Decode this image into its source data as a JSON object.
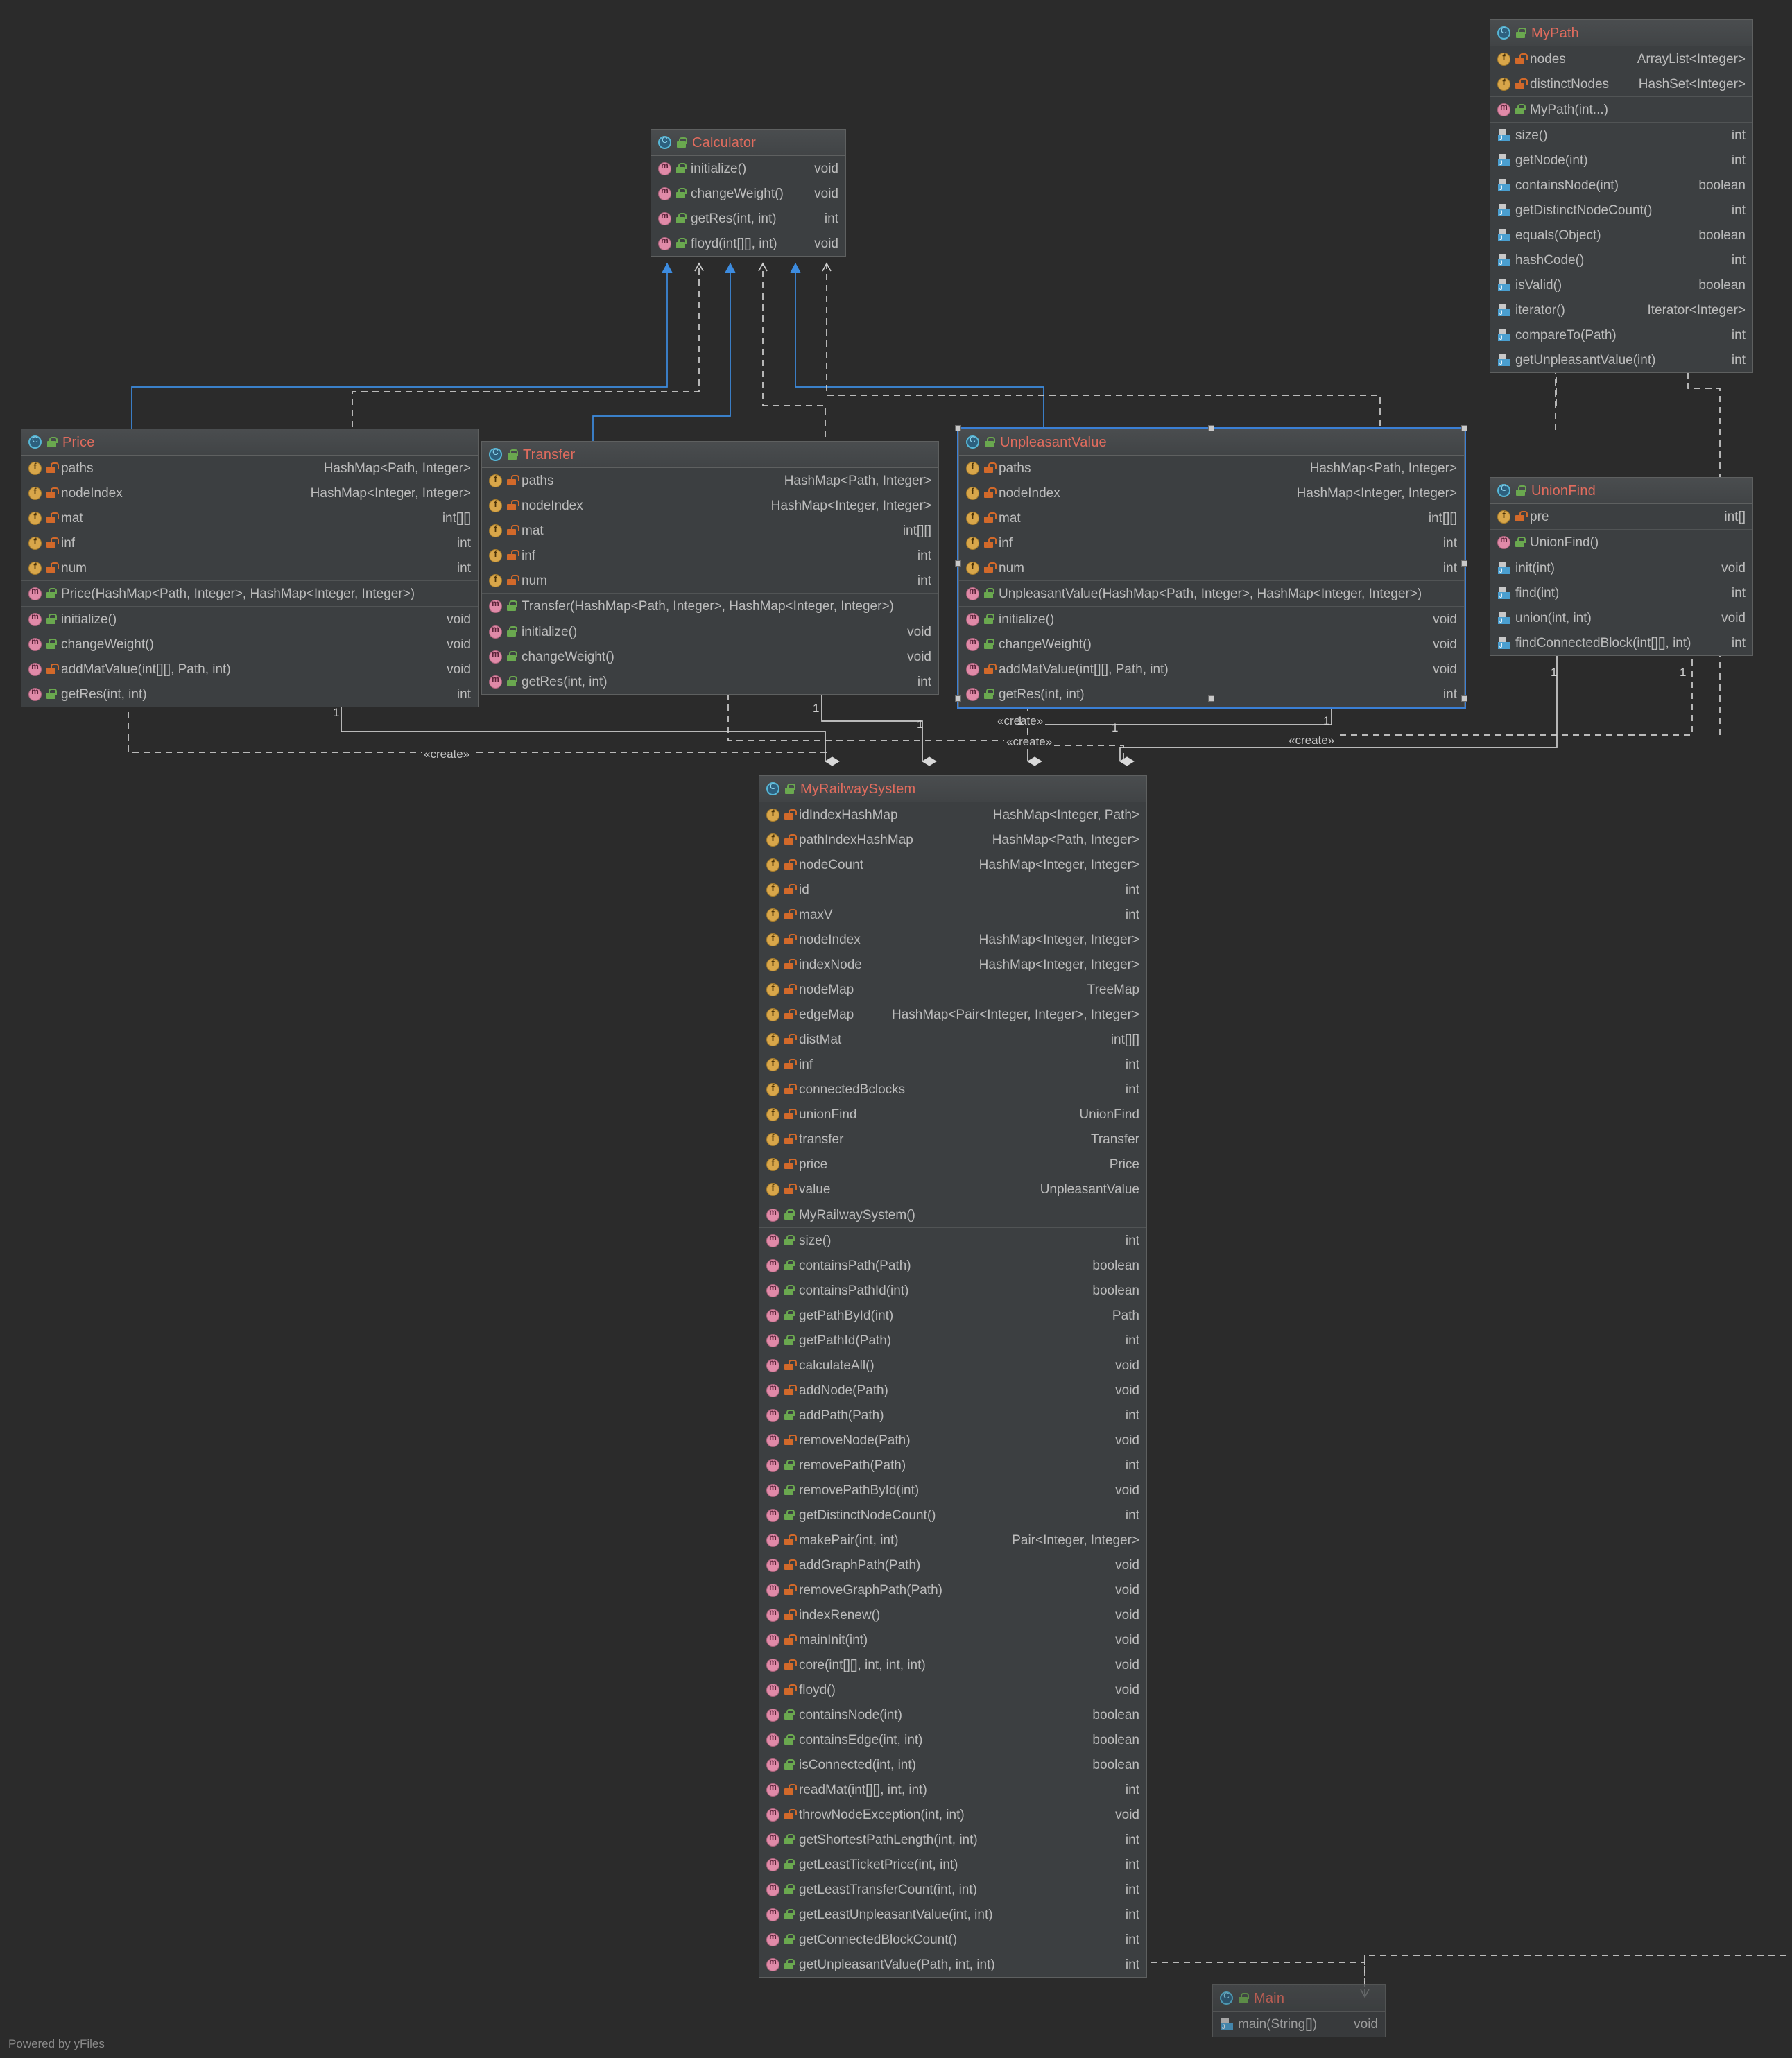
{
  "footer": {
    "text": "Powered by yFiles"
  },
  "edge_labels": [
    "«create»",
    "«create»",
    "«create»",
    "«create»"
  ],
  "multiplicities": [
    "1",
    "1",
    "1",
    "1",
    "1",
    "1",
    "1",
    "1"
  ],
  "classes": {
    "calculator": {
      "name": "Calculator",
      "icon": "class-interface-icon",
      "visibility": "public",
      "sections": [
        {
          "rows": [
            {
              "icon": "method-icon",
              "lock": "public",
              "name": "initialize()",
              "type": "void"
            },
            {
              "icon": "method-icon",
              "lock": "public",
              "name": "changeWeight()",
              "type": "void"
            },
            {
              "icon": "method-icon",
              "lock": "public",
              "name": "getRes(int, int)",
              "type": "int"
            },
            {
              "icon": "method-icon",
              "lock": "public",
              "name": "floyd(int[][], int)",
              "type": "void"
            }
          ]
        }
      ]
    },
    "mypath": {
      "name": "MyPath",
      "icon": "class-icon",
      "visibility": "public",
      "sections": [
        {
          "rows": [
            {
              "icon": "field-icon",
              "lock": "private",
              "name": "nodes",
              "type": "ArrayList<Integer>"
            },
            {
              "icon": "field-icon",
              "lock": "private",
              "name": "distinctNodes",
              "type": "HashSet<Integer>"
            }
          ]
        },
        {
          "rows": [
            {
              "icon": "method-icon",
              "lock": "public",
              "name": "MyPath(int...)",
              "type": ""
            }
          ]
        },
        {
          "rows": [
            {
              "icon": "inherited-icon",
              "lock": "",
              "name": "size()",
              "type": "int"
            },
            {
              "icon": "inherited-icon",
              "lock": "",
              "name": "getNode(int)",
              "type": "int"
            },
            {
              "icon": "inherited-icon",
              "lock": "",
              "name": "containsNode(int)",
              "type": "boolean"
            },
            {
              "icon": "inherited-icon",
              "lock": "",
              "name": "getDistinctNodeCount()",
              "type": "int"
            },
            {
              "icon": "inherited-icon",
              "lock": "",
              "name": "equals(Object)",
              "type": "boolean"
            },
            {
              "icon": "inherited-icon",
              "lock": "",
              "name": "hashCode()",
              "type": "int"
            },
            {
              "icon": "inherited-icon",
              "lock": "",
              "name": "isValid()",
              "type": "boolean"
            },
            {
              "icon": "inherited-icon",
              "lock": "",
              "name": "iterator()",
              "type": "Iterator<Integer>"
            },
            {
              "icon": "inherited-icon",
              "lock": "",
              "name": "compareTo(Path)",
              "type": "int"
            },
            {
              "icon": "inherited-icon",
              "lock": "",
              "name": "getUnpleasantValue(int)",
              "type": "int"
            }
          ]
        }
      ]
    },
    "price": {
      "name": "Price",
      "icon": "class-icon",
      "visibility": "public",
      "sections": [
        {
          "rows": [
            {
              "icon": "field-icon",
              "lock": "private",
              "name": "paths",
              "type": "HashMap<Path, Integer>"
            },
            {
              "icon": "field-icon",
              "lock": "private",
              "name": "nodeIndex",
              "type": "HashMap<Integer, Integer>"
            },
            {
              "icon": "field-icon",
              "lock": "private",
              "name": "mat",
              "type": "int[][]"
            },
            {
              "icon": "field-icon",
              "lock": "private",
              "name": "inf",
              "type": "int"
            },
            {
              "icon": "field-icon",
              "lock": "private",
              "name": "num",
              "type": "int"
            }
          ]
        },
        {
          "rows": [
            {
              "icon": "method-icon",
              "lock": "public",
              "name": "Price(HashMap<Path, Integer>, HashMap<Integer, Integer>)",
              "type": ""
            }
          ]
        },
        {
          "rows": [
            {
              "icon": "method-icon",
              "lock": "public",
              "name": "initialize()",
              "type": "void"
            },
            {
              "icon": "method-icon",
              "lock": "public",
              "name": "changeWeight()",
              "type": "void"
            },
            {
              "icon": "method-icon",
              "lock": "private",
              "name": "addMatValue(int[][], Path, int)",
              "type": "void"
            },
            {
              "icon": "method-icon",
              "lock": "public",
              "name": "getRes(int, int)",
              "type": "int"
            }
          ]
        }
      ]
    },
    "transfer": {
      "name": "Transfer",
      "icon": "class-icon",
      "visibility": "public",
      "sections": [
        {
          "rows": [
            {
              "icon": "field-icon",
              "lock": "private",
              "name": "paths",
              "type": "HashMap<Path, Integer>"
            },
            {
              "icon": "field-icon",
              "lock": "private",
              "name": "nodeIndex",
              "type": "HashMap<Integer, Integer>"
            },
            {
              "icon": "field-icon",
              "lock": "private",
              "name": "mat",
              "type": "int[][]"
            },
            {
              "icon": "field-icon",
              "lock": "private",
              "name": "inf",
              "type": "int"
            },
            {
              "icon": "field-icon",
              "lock": "private",
              "name": "num",
              "type": "int"
            }
          ]
        },
        {
          "rows": [
            {
              "icon": "method-icon",
              "lock": "public",
              "name": "Transfer(HashMap<Path, Integer>, HashMap<Integer, Integer>)",
              "type": ""
            }
          ]
        },
        {
          "rows": [
            {
              "icon": "method-icon",
              "lock": "public",
              "name": "initialize()",
              "type": "void"
            },
            {
              "icon": "method-icon",
              "lock": "public",
              "name": "changeWeight()",
              "type": "void"
            },
            {
              "icon": "method-icon",
              "lock": "public",
              "name": "getRes(int, int)",
              "type": "int"
            }
          ]
        }
      ]
    },
    "unpleasantvalue": {
      "name": "UnpleasantValue",
      "icon": "class-icon",
      "visibility": "public",
      "selected": true,
      "sections": [
        {
          "rows": [
            {
              "icon": "field-icon",
              "lock": "private",
              "name": "paths",
              "type": "HashMap<Path, Integer>"
            },
            {
              "icon": "field-icon",
              "lock": "private",
              "name": "nodeIndex",
              "type": "HashMap<Integer, Integer>"
            },
            {
              "icon": "field-icon",
              "lock": "private",
              "name": "mat",
              "type": "int[][]"
            },
            {
              "icon": "field-icon",
              "lock": "private",
              "name": "inf",
              "type": "int"
            },
            {
              "icon": "field-icon",
              "lock": "private",
              "name": "num",
              "type": "int"
            }
          ]
        },
        {
          "rows": [
            {
              "icon": "method-icon",
              "lock": "public",
              "name": "UnpleasantValue(HashMap<Path, Integer>, HashMap<Integer, Integer>)",
              "type": ""
            }
          ]
        },
        {
          "rows": [
            {
              "icon": "method-icon",
              "lock": "public",
              "name": "initialize()",
              "type": "void"
            },
            {
              "icon": "method-icon",
              "lock": "public",
              "name": "changeWeight()",
              "type": "void"
            },
            {
              "icon": "method-icon",
              "lock": "private",
              "name": "addMatValue(int[][], Path, int)",
              "type": "void"
            },
            {
              "icon": "method-icon",
              "lock": "public",
              "name": "getRes(int, int)",
              "type": "int"
            }
          ]
        }
      ]
    },
    "unionfind": {
      "name": "UnionFind",
      "icon": "class-icon",
      "visibility": "public",
      "sections": [
        {
          "rows": [
            {
              "icon": "field-icon",
              "lock": "private",
              "name": "pre",
              "type": "int[]"
            }
          ]
        },
        {
          "rows": [
            {
              "icon": "method-icon",
              "lock": "public",
              "name": "UnionFind()",
              "type": ""
            }
          ]
        },
        {
          "rows": [
            {
              "icon": "inherited-icon",
              "lock": "",
              "name": "init(int)",
              "type": "void"
            },
            {
              "icon": "inherited-icon",
              "lock": "",
              "name": "find(int)",
              "type": "int"
            },
            {
              "icon": "inherited-icon",
              "lock": "",
              "name": "union(int, int)",
              "type": "void"
            },
            {
              "icon": "inherited-icon",
              "lock": "",
              "name": "findConnectedBlock(int[][], int)",
              "type": "int"
            }
          ]
        }
      ]
    },
    "myrailwaysystem": {
      "name": "MyRailwaySystem",
      "icon": "class-icon",
      "visibility": "public",
      "sections": [
        {
          "rows": [
            {
              "icon": "field-icon",
              "lock": "private",
              "name": "idIndexHashMap",
              "type": "HashMap<Integer, Path>"
            },
            {
              "icon": "field-icon",
              "lock": "private",
              "name": "pathIndexHashMap",
              "type": "HashMap<Path, Integer>"
            },
            {
              "icon": "field-icon",
              "lock": "private",
              "name": "nodeCount",
              "type": "HashMap<Integer, Integer>"
            },
            {
              "icon": "field-icon",
              "lock": "private",
              "name": "id",
              "type": "int"
            },
            {
              "icon": "field-icon",
              "lock": "private",
              "name": "maxV",
              "type": "int"
            },
            {
              "icon": "field-icon",
              "lock": "private",
              "name": "nodeIndex",
              "type": "HashMap<Integer, Integer>"
            },
            {
              "icon": "field-icon",
              "lock": "private",
              "name": "indexNode",
              "type": "HashMap<Integer, Integer>"
            },
            {
              "icon": "field-icon",
              "lock": "private",
              "name": "nodeMap",
              "type": "TreeMap"
            },
            {
              "icon": "field-icon",
              "lock": "private",
              "name": "edgeMap",
              "type": "HashMap<Pair<Integer, Integer>, Integer>"
            },
            {
              "icon": "field-icon",
              "lock": "private",
              "name": "distMat",
              "type": "int[][]"
            },
            {
              "icon": "field-icon",
              "lock": "private",
              "name": "inf",
              "type": "int"
            },
            {
              "icon": "field-icon",
              "lock": "private",
              "name": "connectedBclocks",
              "type": "int"
            },
            {
              "icon": "field-icon",
              "lock": "private",
              "name": "unionFind",
              "type": "UnionFind"
            },
            {
              "icon": "field-icon",
              "lock": "private",
              "name": "transfer",
              "type": "Transfer"
            },
            {
              "icon": "field-icon",
              "lock": "private",
              "name": "price",
              "type": "Price"
            },
            {
              "icon": "field-icon",
              "lock": "private",
              "name": "value",
              "type": "UnpleasantValue"
            }
          ]
        },
        {
          "rows": [
            {
              "icon": "method-icon",
              "lock": "public",
              "name": "MyRailwaySystem()",
              "type": ""
            }
          ]
        },
        {
          "rows": [
            {
              "icon": "method-icon",
              "lock": "public",
              "name": "size()",
              "type": "int"
            },
            {
              "icon": "method-icon",
              "lock": "public",
              "name": "containsPath(Path)",
              "type": "boolean"
            },
            {
              "icon": "method-icon",
              "lock": "public",
              "name": "containsPathId(int)",
              "type": "boolean"
            },
            {
              "icon": "method-icon",
              "lock": "public",
              "name": "getPathById(int)",
              "type": "Path"
            },
            {
              "icon": "method-icon",
              "lock": "public",
              "name": "getPathId(Path)",
              "type": "int"
            },
            {
              "icon": "method-icon",
              "lock": "private",
              "name": "calculateAll()",
              "type": "void"
            },
            {
              "icon": "method-icon",
              "lock": "private",
              "name": "addNode(Path)",
              "type": "void"
            },
            {
              "icon": "method-icon",
              "lock": "public",
              "name": "addPath(Path)",
              "type": "int"
            },
            {
              "icon": "method-icon",
              "lock": "private",
              "name": "removeNode(Path)",
              "type": "void"
            },
            {
              "icon": "method-icon",
              "lock": "public",
              "name": "removePath(Path)",
              "type": "int"
            },
            {
              "icon": "method-icon",
              "lock": "public",
              "name": "removePathById(int)",
              "type": "void"
            },
            {
              "icon": "method-icon",
              "lock": "public",
              "name": "getDistinctNodeCount()",
              "type": "int"
            },
            {
              "icon": "method-icon",
              "lock": "private",
              "name": "makePair(int, int)",
              "type": "Pair<Integer, Integer>"
            },
            {
              "icon": "method-icon",
              "lock": "private",
              "name": "addGraphPath(Path)",
              "type": "void"
            },
            {
              "icon": "method-icon",
              "lock": "private",
              "name": "removeGraphPath(Path)",
              "type": "void"
            },
            {
              "icon": "method-icon",
              "lock": "private",
              "name": "indexRenew()",
              "type": "void"
            },
            {
              "icon": "method-icon",
              "lock": "private",
              "name": "mainInit(int)",
              "type": "void"
            },
            {
              "icon": "method-icon",
              "lock": "private",
              "name": "core(int[][], int, int, int)",
              "type": "void"
            },
            {
              "icon": "method-icon",
              "lock": "private",
              "name": "floyd()",
              "type": "void"
            },
            {
              "icon": "method-icon",
              "lock": "public",
              "name": "containsNode(int)",
              "type": "boolean"
            },
            {
              "icon": "method-icon",
              "lock": "public",
              "name": "containsEdge(int, int)",
              "type": "boolean"
            },
            {
              "icon": "method-icon",
              "lock": "public",
              "name": "isConnected(int, int)",
              "type": "boolean"
            },
            {
              "icon": "method-icon",
              "lock": "private",
              "name": "readMat(int[][], int, int)",
              "type": "int"
            },
            {
              "icon": "method-icon",
              "lock": "private",
              "name": "throwNodeException(int, int)",
              "type": "void"
            },
            {
              "icon": "method-icon",
              "lock": "public",
              "name": "getShortestPathLength(int, int)",
              "type": "int"
            },
            {
              "icon": "method-icon",
              "lock": "public",
              "name": "getLeastTicketPrice(int, int)",
              "type": "int"
            },
            {
              "icon": "method-icon",
              "lock": "public",
              "name": "getLeastTransferCount(int, int)",
              "type": "int"
            },
            {
              "icon": "method-icon",
              "lock": "public",
              "name": "getLeastUnpleasantValue(int, int)",
              "type": "int"
            },
            {
              "icon": "method-icon",
              "lock": "public",
              "name": "getConnectedBlockCount()",
              "type": "int"
            },
            {
              "icon": "method-icon",
              "lock": "public",
              "name": "getUnpleasantValue(Path, int, int)",
              "type": "int"
            }
          ]
        }
      ]
    },
    "main": {
      "name": "Main",
      "icon": "class-runnable-icon",
      "visibility": "public",
      "sections": [
        {
          "rows": [
            {
              "icon": "inherited-icon",
              "lock": "",
              "name": "main(String[])",
              "type": "void"
            }
          ]
        }
      ]
    }
  }
}
